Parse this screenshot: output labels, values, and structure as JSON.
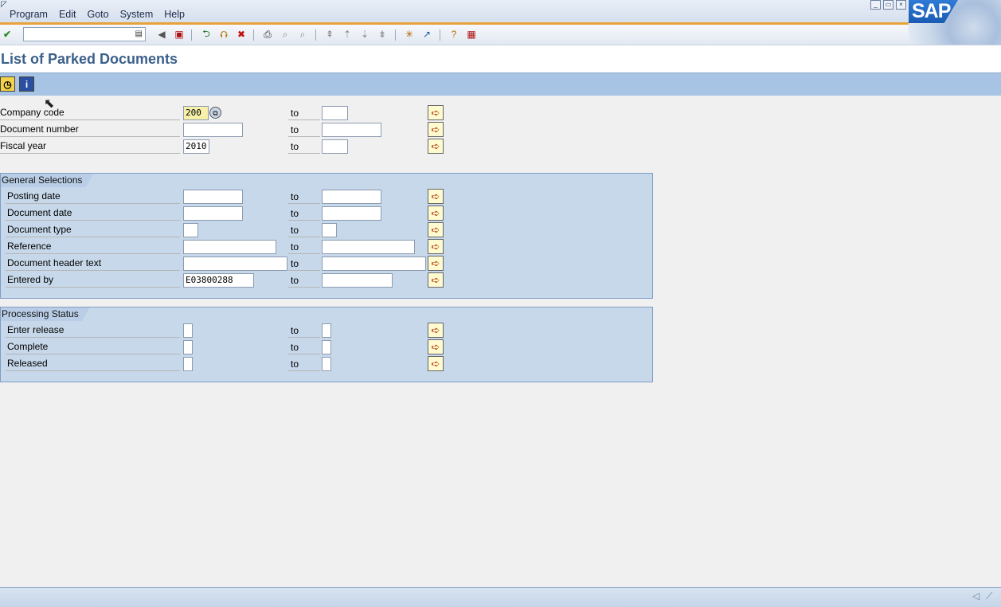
{
  "menu": [
    "Program",
    "Edit",
    "Goto",
    "System",
    "Help"
  ],
  "window_buttons": [
    "_",
    "▭",
    "×"
  ],
  "brand": "SAP",
  "title": "List of Parked Documents",
  "header_fields": [
    {
      "label": "Company code",
      "from": "200",
      "to": ""
    },
    {
      "label": "Document number",
      "from": "",
      "to": ""
    },
    {
      "label": "Fiscal year",
      "from": "2010",
      "to": ""
    }
  ],
  "to_label": "to",
  "general": {
    "title": "General Selections",
    "fields": [
      {
        "label": "Posting date",
        "from": "",
        "to": ""
      },
      {
        "label": "Document date",
        "from": "",
        "to": ""
      },
      {
        "label": "Document type",
        "from": "",
        "to": ""
      },
      {
        "label": "Reference",
        "from": "",
        "to": ""
      },
      {
        "label": "Document header text",
        "from": "",
        "to": ""
      },
      {
        "label": "Entered by",
        "from": "E03800288",
        "to": ""
      }
    ]
  },
  "status": {
    "title": "Processing Status",
    "fields": [
      {
        "label": "Enter release",
        "from": "",
        "to": ""
      },
      {
        "label": "Complete",
        "from": "",
        "to": ""
      },
      {
        "label": "Released",
        "from": "",
        "to": ""
      }
    ]
  }
}
